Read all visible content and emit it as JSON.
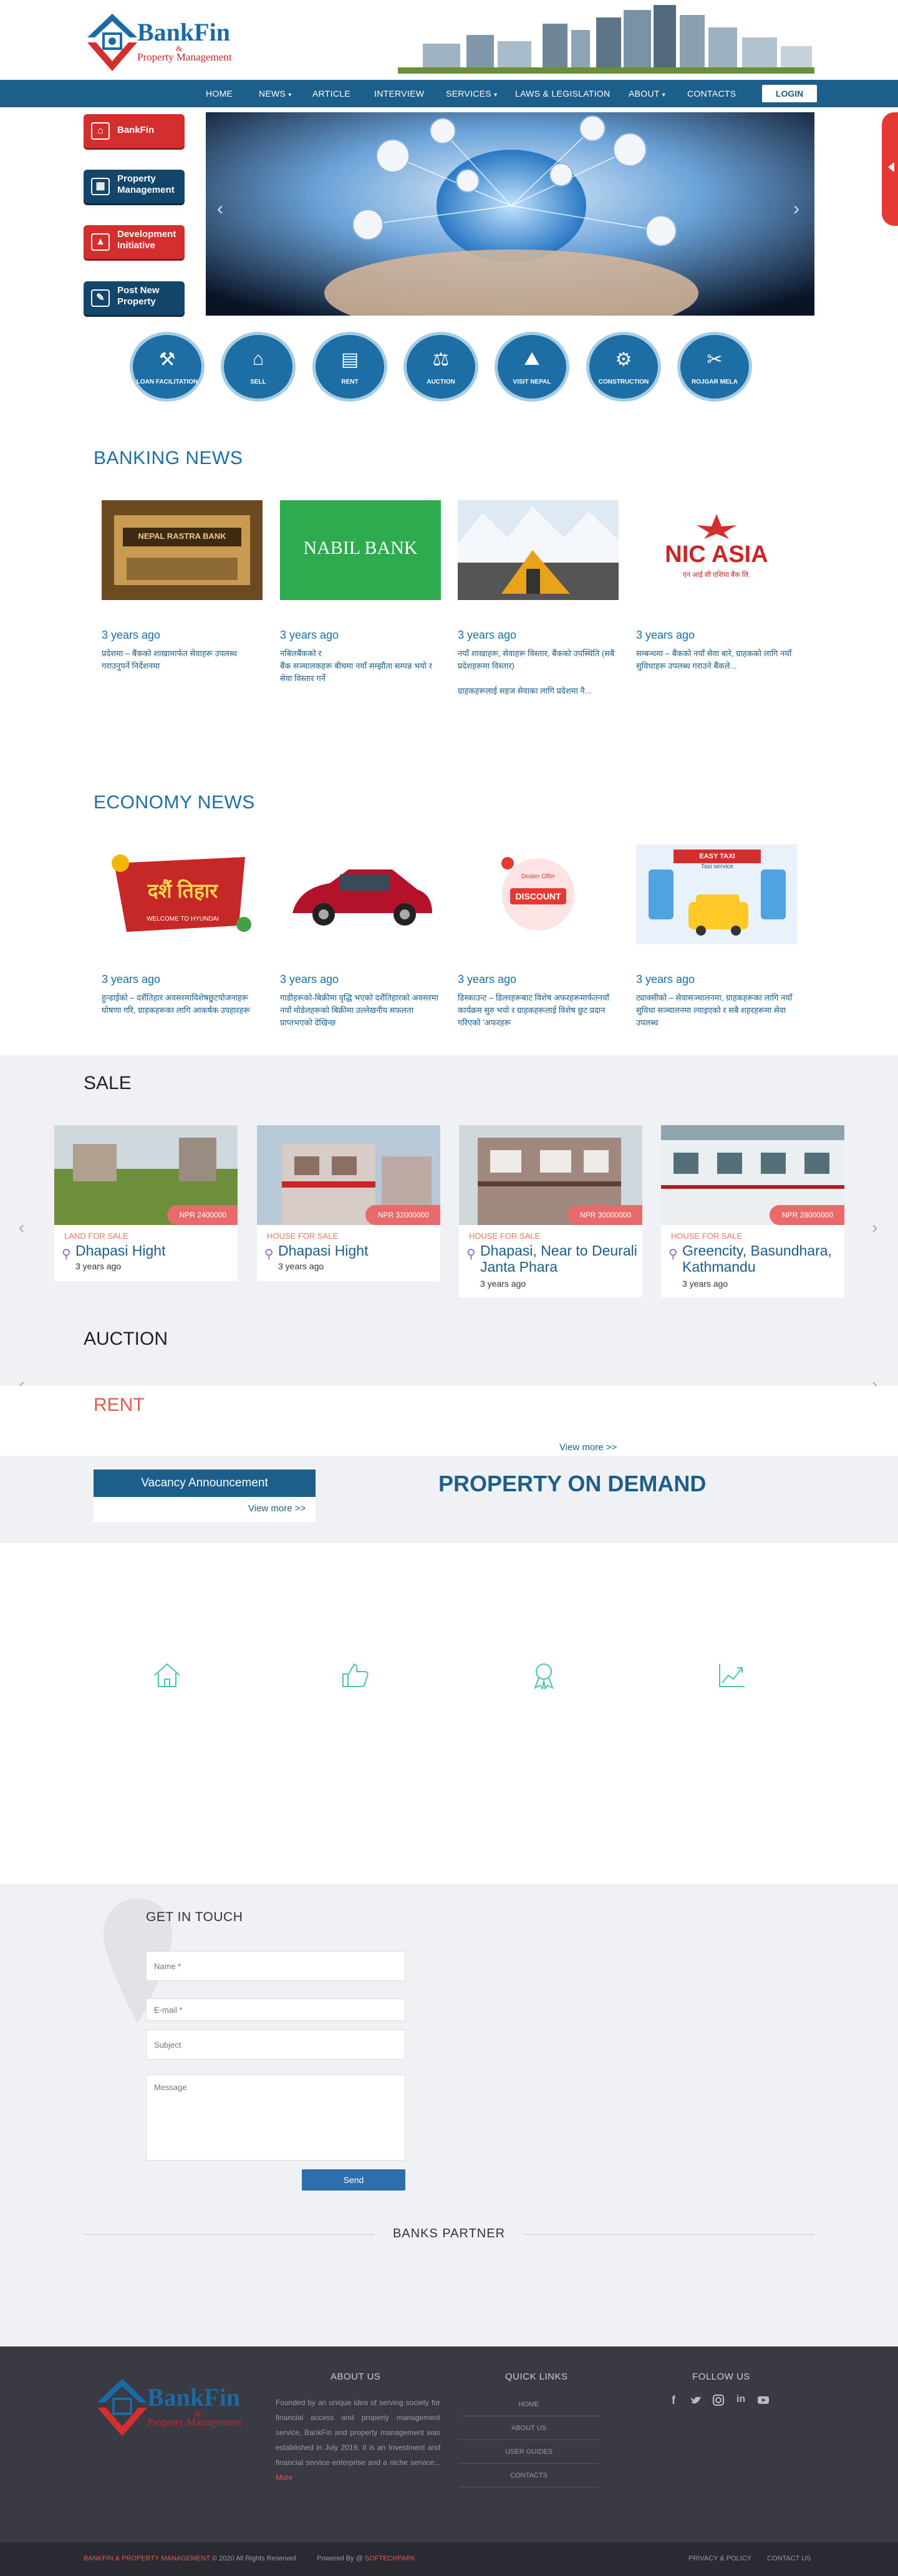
{
  "brand": {
    "name": "BankFin",
    "sub_amp": "&",
    "sub": "Property Management"
  },
  "nav": {
    "items": [
      "HOME",
      "NEWS",
      "ARTICLE",
      "INTERVIEW",
      "SERVICES",
      "LAWS & LEGISLATION",
      "ABOUT",
      "CONTACTS"
    ],
    "login": "LOGIN"
  },
  "side_buttons": [
    {
      "label": "BankFin",
      "icon": "bank-icon"
    },
    {
      "label": "Property Management",
      "icon": "building-icon"
    },
    {
      "label": "Development Initiative",
      "icon": "chart-icon"
    },
    {
      "label": "Post New Property",
      "icon": "post-icon"
    }
  ],
  "services": [
    {
      "label": "LOAN FACILITATION",
      "icon": "loan-icon"
    },
    {
      "label": "SELL",
      "icon": "sell-icon"
    },
    {
      "label": "RENT",
      "icon": "rent-icon"
    },
    {
      "label": "AUCTION",
      "icon": "gavel-icon"
    },
    {
      "label": "VISIT NEPAL",
      "icon": "visit-icon"
    },
    {
      "label": "CONSTRUCTION",
      "icon": "crane-icon"
    },
    {
      "label": "ROJGAR MELA",
      "icon": "jobs-icon"
    }
  ],
  "banking_news": {
    "title": "BANKING NEWS",
    "items": [
      {
        "img_text": "NEPAL RASTRA BANK",
        "date": "3 years ago",
        "text": "प्रदेशमा – बैंकको शाखामार्फत सेवाहरू उपलब्ध गराउनुपर्ने निर्देशनमा"
      },
      {
        "img_text": "NABIL BANK",
        "date": "3 years ago",
        "text": "नबिलबैंकको र\nबैंक सञ्चालकहरू बीचमा नयाँ सम्झौता सम्पन्न भयो र सेवा विस्तार गर्ने"
      },
      {
        "img_text": "",
        "date": "3 years ago",
        "text": "नयाँ शाखाहरू, सेवाहरू विस्तार, बैंकको उपस्थिति (सबै प्रदेशहरूमा विस्तार)\n\nग्राहकहरूलाई सहज सेवाका लागि प्रदेशमा नै..."
      },
      {
        "img_text": "NIC ASIA",
        "img_sub": "एन आई सी एशिया बैंक लि.",
        "date": "3 years ago",
        "text": "सम्बन्धमा – बैंकको नयाँ सेवा बारे, ग्राहकको लागि नयाँ सुविधाहरू उपलब्ध गराउने बैंकले..."
      }
    ]
  },
  "economy_news": {
    "title": "ECONOMY NEWS",
    "items": [
      {
        "img_text": "दशैं तिहार",
        "img_sub": "WELCOME TO HYUNDAI",
        "date": "3 years ago",
        "text": "हुन्डाईको – दशैंतिहार अवसरमाविशेषछुटयोजनाहरू घोषणा गरि, ग्राहकहरूका लागि आकर्षक उपहारहरू"
      },
      {
        "img_text": "",
        "date": "3 years ago",
        "text": "गाडीहरूको-बिक्रीमा वृद्धि भएको दशैंतिहारको अवसरमा नयाँ मोडेलहरूको बिक्रीमा उल्लेखनीय सफलता प्राप्तभएको देखिन्छ"
      },
      {
        "img_text": "DISCOUNT",
        "img_sub": "Dealer Offer",
        "date": "3 years ago",
        "text": "डिस्काउन्ट – डिलरहरूबाट विशेष अफरहरूमार्फतनयाँ कार्यक्रम सुरु भयो र ग्राहकहरूलाई विशेष छुट प्रदान गरिएको 'अफरहरू"
      },
      {
        "img_text": "EASY TAXI",
        "img_sub": "Taxi service",
        "date": "3 years ago",
        "text": "ट्याक्सीको – सेवासञ्चालनमा, ग्राहकहरूका लागि नयाँ सुविधा सञ्चालनमा ल्याइएको र सबै शहरहरूमा सेवा उपलब्ध"
      }
    ]
  },
  "sale": {
    "title": "SALE",
    "items": [
      {
        "price": "NPR 2400000",
        "category": "LAND FOR SALE",
        "name": "Dhapasi Hight",
        "age": "3 years ago"
      },
      {
        "price": "NPR 32000000",
        "category": "HOUSE FOR SALE",
        "name": "Dhapasi Hight",
        "age": "3 years ago"
      },
      {
        "price": "NPR 30000000",
        "category": "HOUSE FOR SALE",
        "name": "Dhapasi, Near to Deurali Janta Phara",
        "age": "3 years ago"
      },
      {
        "price": "NPR 28000000",
        "category": "HOUSE FOR SALE",
        "name": "Greencity, Basundhara, Kathmandu",
        "age": "3 years ago"
      }
    ]
  },
  "auction": {
    "title": "AUCTION"
  },
  "rent": {
    "title": "RENT",
    "view_more": "View more >>"
  },
  "vacancy": {
    "title": "Vacancy Announcement",
    "view_more": "View more >>"
  },
  "pod": {
    "title": "PROPERTY ON DEMAND"
  },
  "features": [
    {
      "icon": "home-icon"
    },
    {
      "icon": "thumbs-up-icon"
    },
    {
      "icon": "award-icon"
    },
    {
      "icon": "growth-chart-icon"
    }
  ],
  "contact": {
    "title": "GET IN TOUCH",
    "name_ph": "Name *",
    "email_ph": "E-mail *",
    "subject_ph": "Subject",
    "message_ph": "Message",
    "send": "Send"
  },
  "partners": {
    "title": "BANKS PARTNER"
  },
  "footer": {
    "about_title": "ABOUT US",
    "about_text": "Founded by an unique idea of serving society for financial access and property management service, BankFin and property management was established in July 2019. It is an Investment and financial service enterprise and a niche service...",
    "more": "More",
    "quick_title": "QUICK LINKS",
    "links": [
      "HOME",
      "ABOUT US",
      "USER GUIDES",
      "CONTACTS"
    ],
    "follow_title": "FOLLOW US",
    "social": [
      "facebook-icon",
      "twitter-icon",
      "instagram-icon",
      "linkedin-icon",
      "youtube-icon"
    ],
    "copyright_brand": "BANKFIN & PROPERTY MANAGEMENT",
    "copyright": "© 2020 All Rights Reserved.",
    "powered": "Powered By @",
    "powered_brand": "SOFTECHPARK",
    "privacy": "PRIVACY & POLICY",
    "contact_us": "CONTACT US"
  },
  "colors": {
    "primary": "#1c6ea4",
    "nav": "#1c5f8a",
    "accent": "#d32f2f",
    "dark": "#13466a",
    "footer": "#3a3a44"
  }
}
